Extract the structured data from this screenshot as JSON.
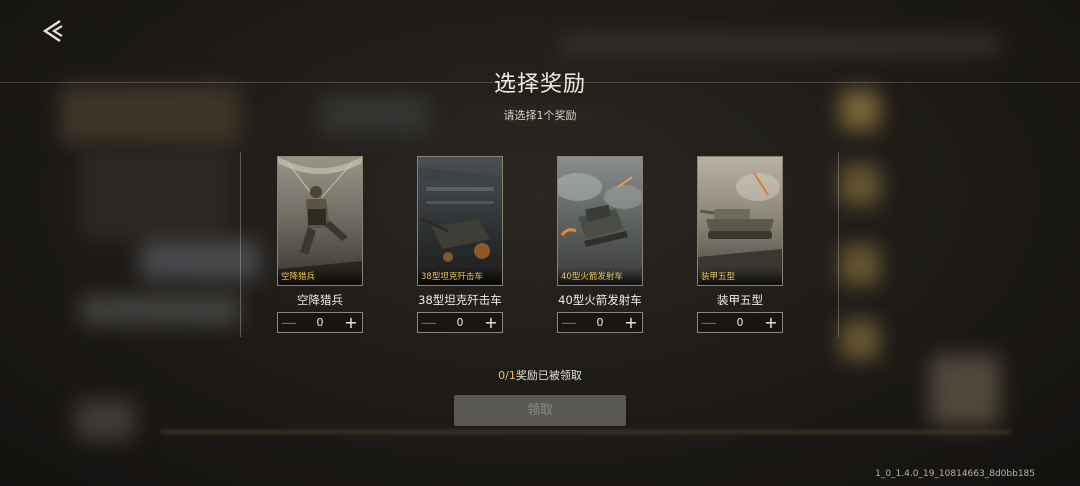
{
  "title": "选择奖励",
  "subtitle": "请选择1个奖励",
  "rewards": [
    {
      "tag": "空降猎兵",
      "name": "空降猎兵",
      "count": "0"
    },
    {
      "tag": "38型坦克歼击车",
      "name": "38型坦克歼击车",
      "count": "0"
    },
    {
      "tag": "40型火箭发射车",
      "name": "40型火箭发射车",
      "count": "0"
    },
    {
      "tag": "装甲五型",
      "name": "装甲五型",
      "count": "0"
    }
  ],
  "stepper": {
    "minus": "—",
    "plus": "+"
  },
  "status": {
    "claimed": "0/1",
    "suffix": "奖励已被领取"
  },
  "claim_button": "领取",
  "version": "1_0_1.4.0_19_10814663_8d0bb185",
  "icons": {
    "back": "double-chevron-left-icon",
    "minus": "minus-icon",
    "plus": "plus-icon"
  },
  "colors": {
    "accent_gold": "#e9c55a",
    "button_disabled": "#8c8a84"
  }
}
